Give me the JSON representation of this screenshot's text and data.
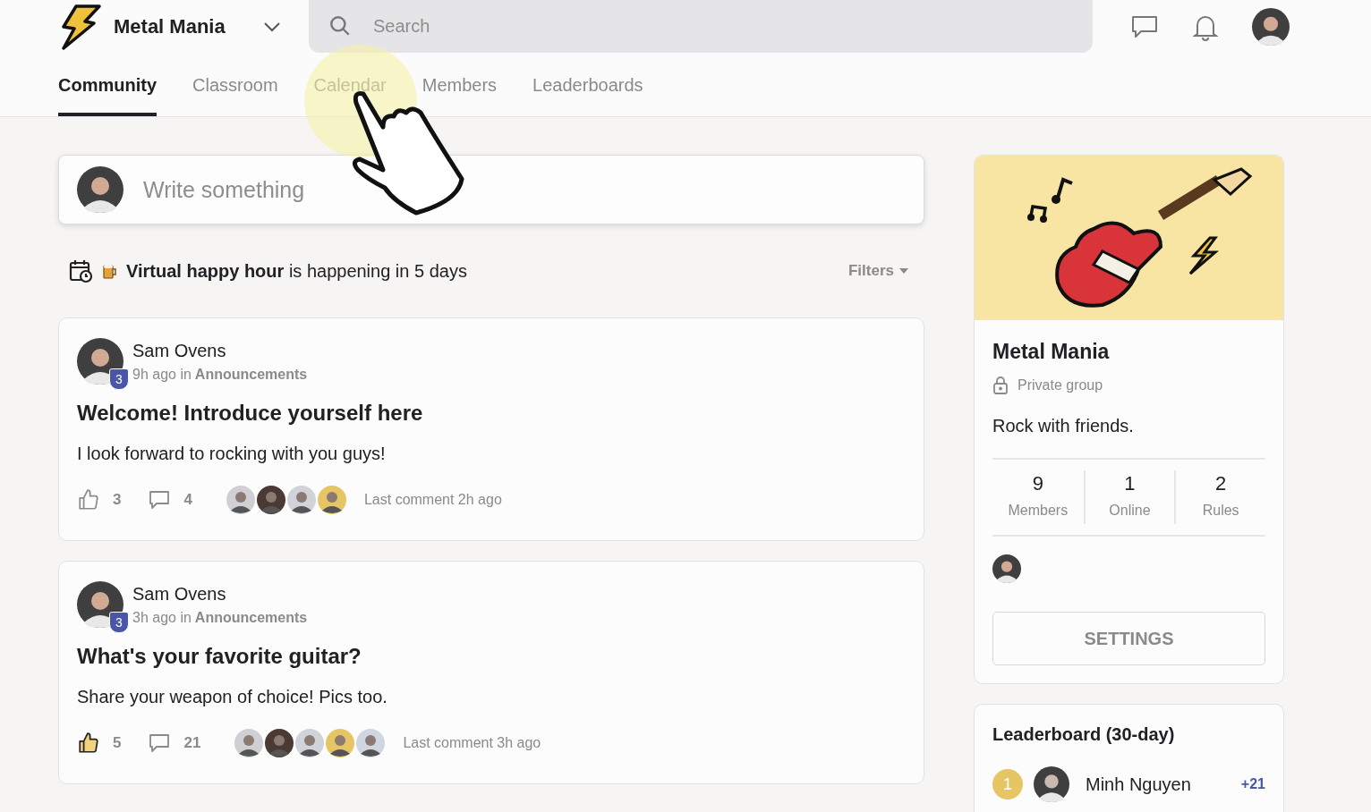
{
  "header": {
    "group_name": "Metal Mania",
    "search": {
      "placeholder": "Search"
    }
  },
  "tabs": [
    {
      "label": "Community",
      "selected": true
    },
    {
      "label": "Classroom",
      "selected": false
    },
    {
      "label": "Calendar",
      "selected": false
    },
    {
      "label": "Members",
      "selected": false
    },
    {
      "label": "Leaderboards",
      "selected": false
    }
  ],
  "composer": {
    "placeholder": "Write something"
  },
  "event_banner": {
    "text": "**Virtual happy hour** is happening in 5 days",
    "filters": "Filters"
  },
  "posts": [
    {
      "author": "Sam Ovens",
      "level": "3",
      "time": "9h ago in",
      "category": "Announcements",
      "title": "Welcome! Introduce yourself here",
      "body": "I look forward to rocking with you guys!",
      "likes": "3",
      "liked": false,
      "comments": "4",
      "commenters": [
        {
          "kind": "photo"
        },
        {
          "kind": "photo"
        },
        {
          "kind": "photo"
        },
        {
          "kind": "photo"
        }
      ],
      "last_comment": "Last comment 2h ago"
    },
    {
      "author": "Sam Ovens",
      "level": "3",
      "time": "3h ago in",
      "category": "Announcements",
      "title": "What's your favorite guitar?",
      "body": "Share your weapon of choice! Pics too.",
      "likes": "5",
      "liked": true,
      "comments": "21",
      "commenters": [
        {
          "kind": "photo"
        },
        {
          "kind": "photo"
        },
        {
          "kind": "photo"
        },
        {
          "kind": "photo"
        },
        {
          "kind": "photo"
        }
      ],
      "last_comment": "Last comment 3h ago"
    }
  ],
  "group_card": {
    "name": "Metal Mania",
    "privacy": "Private group",
    "description": "Rock with friends.",
    "stats": [
      {
        "value": "9",
        "label": "Members"
      },
      {
        "value": "1",
        "label": "Online"
      },
      {
        "value": "2",
        "label": "Rules"
      }
    ],
    "settings_button": "SETTINGS"
  },
  "leaderboard": {
    "title": "Leaderboard (30-day)",
    "entries": [
      {
        "rank": "1",
        "name": "Minh Nguyen",
        "points": "+21"
      }
    ]
  }
}
